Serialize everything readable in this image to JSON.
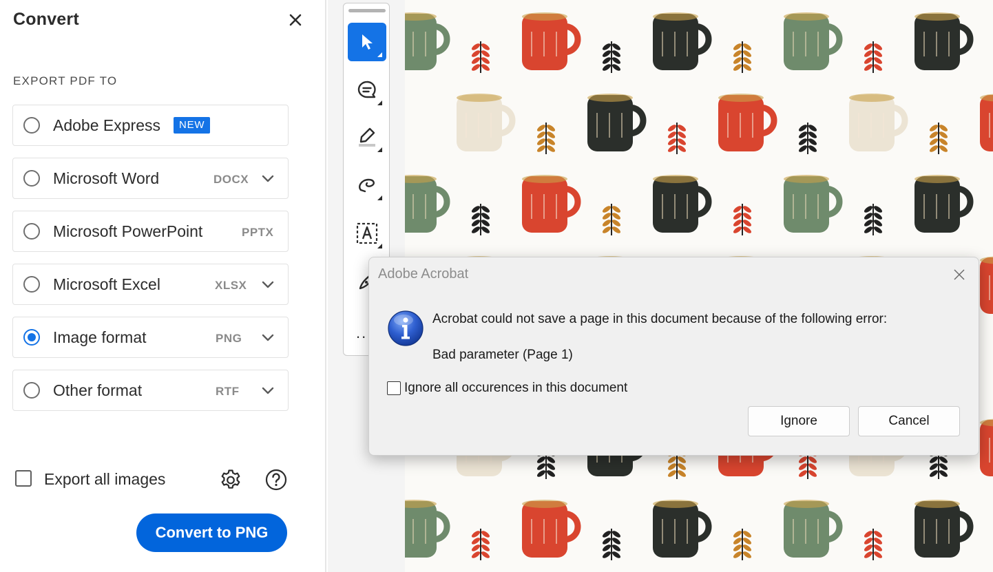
{
  "panel": {
    "title": "Convert",
    "section_label": "EXPORT PDF TO",
    "options": [
      {
        "label": "Adobe Express",
        "badge": "NEW",
        "ext": "",
        "selected": false,
        "has_dropdown": false
      },
      {
        "label": "Microsoft Word",
        "ext": "DOCX",
        "selected": false,
        "has_dropdown": true
      },
      {
        "label": "Microsoft PowerPoint",
        "ext": "PPTX",
        "selected": false,
        "has_dropdown": false
      },
      {
        "label": "Microsoft Excel",
        "ext": "XLSX",
        "selected": false,
        "has_dropdown": true
      },
      {
        "label": "Image format",
        "ext": "PNG",
        "selected": true,
        "has_dropdown": true
      },
      {
        "label": "Other format",
        "ext": "RTF",
        "selected": false,
        "has_dropdown": true
      }
    ],
    "export_all_images": {
      "label": "Export all images",
      "checked": false
    },
    "convert_button": "Convert to PNG",
    "icons": {
      "close": "close-icon",
      "settings": "gear-icon",
      "help": "help-icon"
    }
  },
  "toolbar": {
    "tools": [
      "select-icon",
      "comment-icon",
      "highlight-icon",
      "draw-icon",
      "text-box-icon",
      "signature-icon"
    ],
    "more": "..."
  },
  "dialog": {
    "title": "Adobe Acrobat",
    "message": "Acrobat could not save a page in this document because of the following error:",
    "error": "Bad parameter (Page 1)",
    "checkbox_label": "Ignore all occurences in this document",
    "ignore_button": "Ignore",
    "cancel_button": "Cancel"
  },
  "colors": {
    "accent": "#1473e6",
    "convert_button": "#0265dc",
    "mug_red": "#d9452f",
    "mug_green": "#6f8b6c",
    "mug_black": "#2b2f2b",
    "mug_cream": "#ece4d4"
  }
}
